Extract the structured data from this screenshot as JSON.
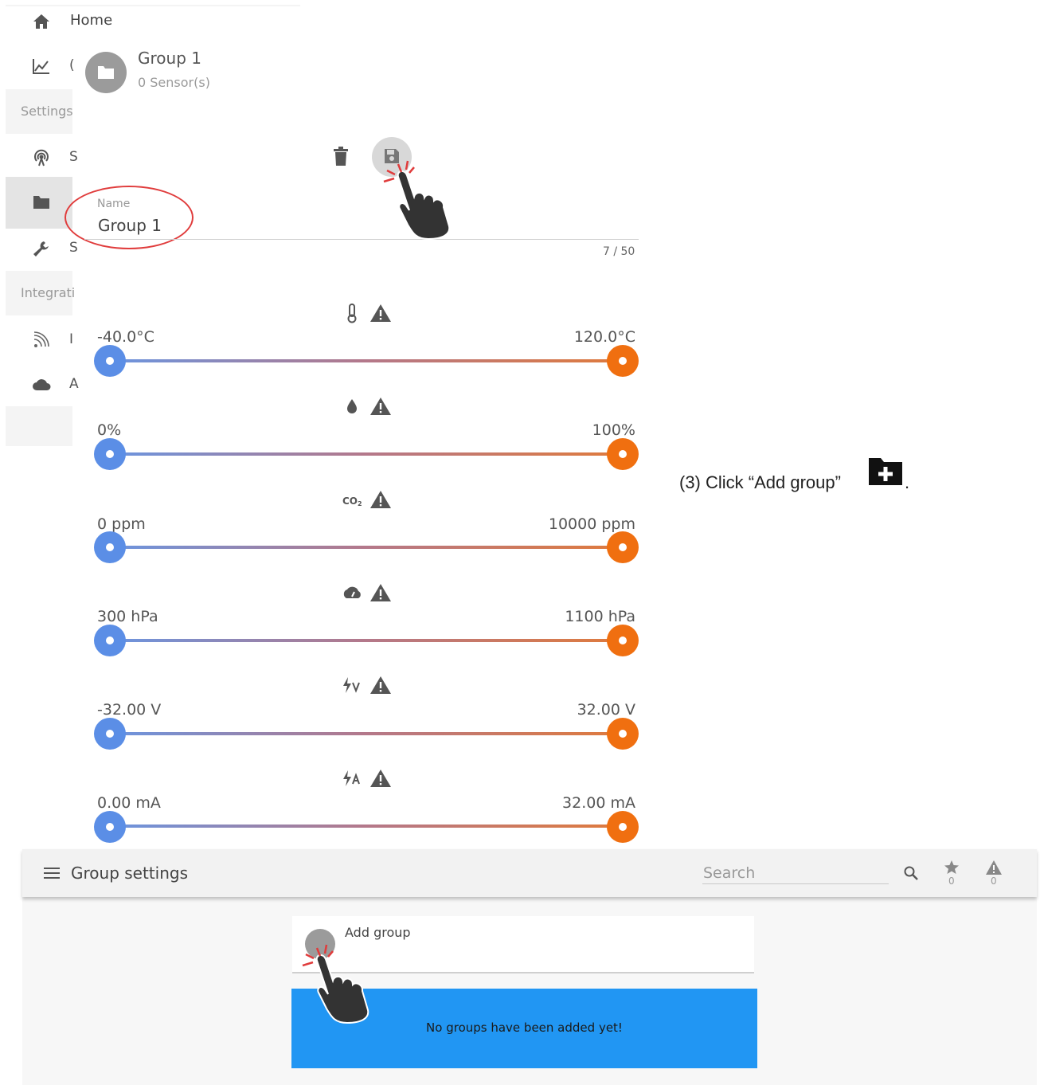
{
  "sidebar": {
    "home_label": "Home",
    "settings_section": "Settings",
    "integrations_section": "Integrati",
    "row_cut_letters": [
      "(",
      "S",
      "S",
      "I",
      "A"
    ]
  },
  "group_card": {
    "title": "Group 1",
    "subtitle": "0 Sensor(s)"
  },
  "name_field": {
    "label": "Name",
    "value": "Group 1",
    "counter": "7 / 50"
  },
  "sliders": [
    {
      "icon": "thermometer-icon",
      "min_label": "-40.0°C",
      "max_label": "120.0°C"
    },
    {
      "icon": "humidity-drop-icon",
      "min_label": "0%",
      "max_label": "100%"
    },
    {
      "icon": "co2-icon",
      "min_label": "0 ppm",
      "max_label": "10000 ppm"
    },
    {
      "icon": "pressure-gauge-icon",
      "min_label": "300 hPa",
      "max_label": "1100 hPa"
    },
    {
      "icon": "voltage-icon",
      "min_label": "-32.00 V",
      "max_label": "32.00 V"
    },
    {
      "icon": "current-icon",
      "min_label": "0.00 mA",
      "max_label": "32.00 mA"
    }
  ],
  "instruction": {
    "text": "(3) Click “Add group” ",
    "suffix": "."
  },
  "appbar": {
    "title": "Group settings",
    "search_placeholder": "Search",
    "favorites_count": "0",
    "alerts_count": "0"
  },
  "add_group": {
    "label": "Add group"
  },
  "empty_state": {
    "message": "No groups have been added yet!"
  },
  "colors": {
    "slider_min": "#5b8ee6",
    "slider_max": "#f06f10",
    "banner": "#2196f3",
    "highlight_ring": "#e03c3c"
  }
}
